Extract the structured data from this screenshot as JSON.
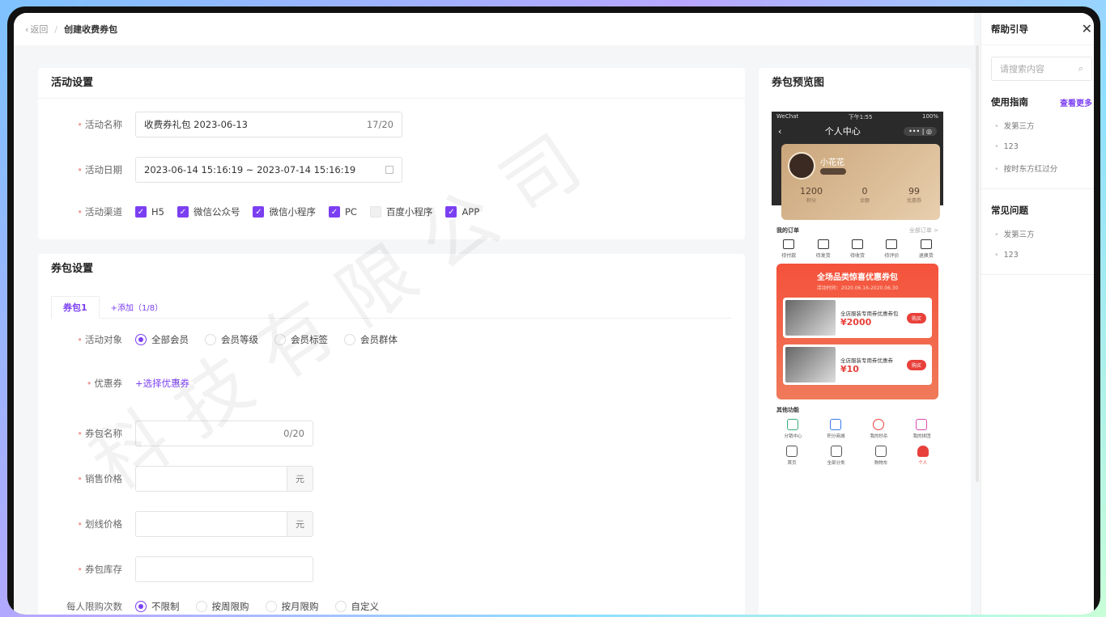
{
  "topbar": {
    "back_label": "返回",
    "crumb": "创建收费券包"
  },
  "activity": {
    "title": "活动设置",
    "name_label": "活动名称",
    "name_value": "收费券礼包  2023-06-13",
    "name_count": "17/20",
    "date_label": "活动日期",
    "date_value": "2023-06-14 15:16:19 ~ 2023-07-14 15:16:19",
    "channel_label": "活动渠道",
    "channels": [
      {
        "label": "H5",
        "checked": true
      },
      {
        "label": "微信公众号",
        "checked": true
      },
      {
        "label": "微信小程序",
        "checked": true
      },
      {
        "label": "PC",
        "checked": true
      },
      {
        "label": "百度小程序",
        "checked": false
      },
      {
        "label": "APP",
        "checked": true
      }
    ]
  },
  "coupon": {
    "title": "券包设置",
    "tab_active": "券包1",
    "tab_add": "+添加（1/8）",
    "target_label": "活动对象",
    "targets": [
      "全部会员",
      "会员等级",
      "会员标签",
      "会员群体"
    ],
    "coupon_label": "优惠券",
    "select_coupon": "+选择优惠券",
    "pack_name_label": "券包名称",
    "pack_name_count": "0/20",
    "price_label": "销售价格",
    "strike_label": "划线价格",
    "unit": "元",
    "stock_label": "券包库存",
    "limit_label": "每人限购次数",
    "limits": [
      "不限制",
      "按周限购",
      "按月限购",
      "自定义"
    ]
  },
  "preview": {
    "title": "券包预览图",
    "status_left": "WeChat",
    "status_time": "下午1:55",
    "status_battery": "100%",
    "page_title": "个人中心",
    "user_name": "小花花",
    "stats": [
      {
        "value": "1200",
        "label": "积分"
      },
      {
        "value": "0",
        "label": "余额"
      },
      {
        "value": "99",
        "label": "优惠券"
      }
    ],
    "orders_title": "我的订单",
    "orders_more": "全部订单 >",
    "orders": [
      "待付款",
      "待发货",
      "待收货",
      "待评价",
      "退换货"
    ],
    "promo_title": "全场品类惊喜优惠券包",
    "promo_sub": "活动时间：2020.06.16-2020.06.30",
    "items": [
      {
        "name": "全店服装专用券优惠券包",
        "price": "¥2000",
        "buy": "购买"
      },
      {
        "name": "全店服装专用券优惠券",
        "price": "¥10",
        "buy": "购买"
      }
    ],
    "funcs_title": "其他功能",
    "funcs": [
      {
        "label": "分销中心",
        "color": "#3aa876"
      },
      {
        "label": "积分商城",
        "color": "#3a7be8"
      },
      {
        "label": "我的秒杀",
        "color": "#e8403a"
      },
      {
        "label": "我的拼团",
        "color": "#d84ab0"
      }
    ],
    "tabbar": [
      "首页",
      "全部分类",
      "购物车",
      "个人"
    ]
  },
  "help": {
    "title": "帮助引导",
    "search_placeholder": "请搜索内容",
    "guide_title": "使用指南",
    "guide_more": "查看更多",
    "guide_items": [
      "发第三方",
      "123",
      "按时东方红过分"
    ],
    "faq_title": "常见问题",
    "faq_items": [
      "发第三方",
      "123"
    ]
  },
  "watermark": "科技有限公司",
  "colors": {
    "accent": "#7b3ff2",
    "promo": "#f4523b"
  }
}
